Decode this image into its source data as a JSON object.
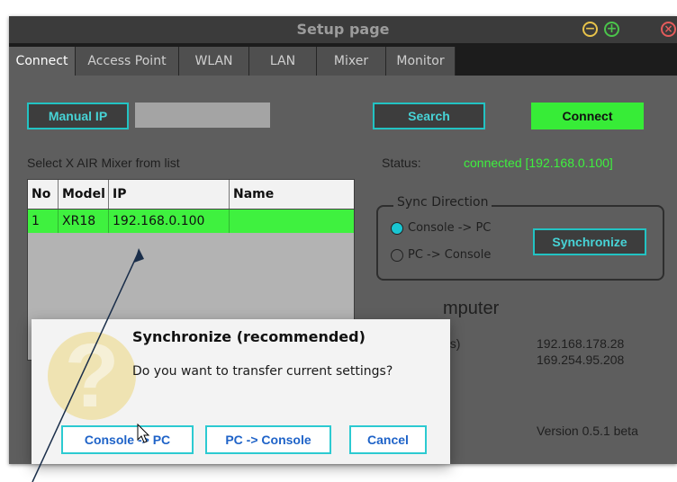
{
  "window": {
    "title": "Setup page"
  },
  "tabs": [
    "Connect",
    "Access Point",
    "WLAN",
    "LAN",
    "Mixer",
    "Monitor"
  ],
  "connect": {
    "manual_ip_label": "Manual IP",
    "ip_value": "",
    "search_label": "Search",
    "connect_label": "Connect",
    "select_text": "Select X AIR Mixer from list",
    "status_label": "Status:",
    "status_value": "connected [192.168.0.100]"
  },
  "mixer_list": {
    "headers": [
      "No",
      "Model",
      "IP",
      "Name"
    ],
    "rows": [
      {
        "no": "1",
        "model": "XR18",
        "ip": "192.168.0.100",
        "name": ""
      }
    ]
  },
  "sync": {
    "legend": "Sync Direction",
    "option1": "Console -> PC",
    "option2": "PC -> Console",
    "selected": "Console -> PC",
    "button": "Synchronize"
  },
  "computer": {
    "heading_partial": "mputer",
    "label_partial": "es)",
    "ip1": "192.168.178.28",
    "ip2": "169.254.95.208",
    "version": "Version 0.5.1 beta"
  },
  "dialog": {
    "title": "Synchronize (recommended)",
    "message": "Do you want to transfer current settings?",
    "btn_console_pc": "Console -> PC",
    "btn_pc_console": "PC -> Console",
    "btn_cancel": "Cancel",
    "icon": "question-icon"
  },
  "colors": {
    "accent": "#22c3c3",
    "connect_green": "#37ec37",
    "status_green": "#3ef03e",
    "row_green": "#3ff13f",
    "dialog_button_text": "#1f63c8"
  }
}
